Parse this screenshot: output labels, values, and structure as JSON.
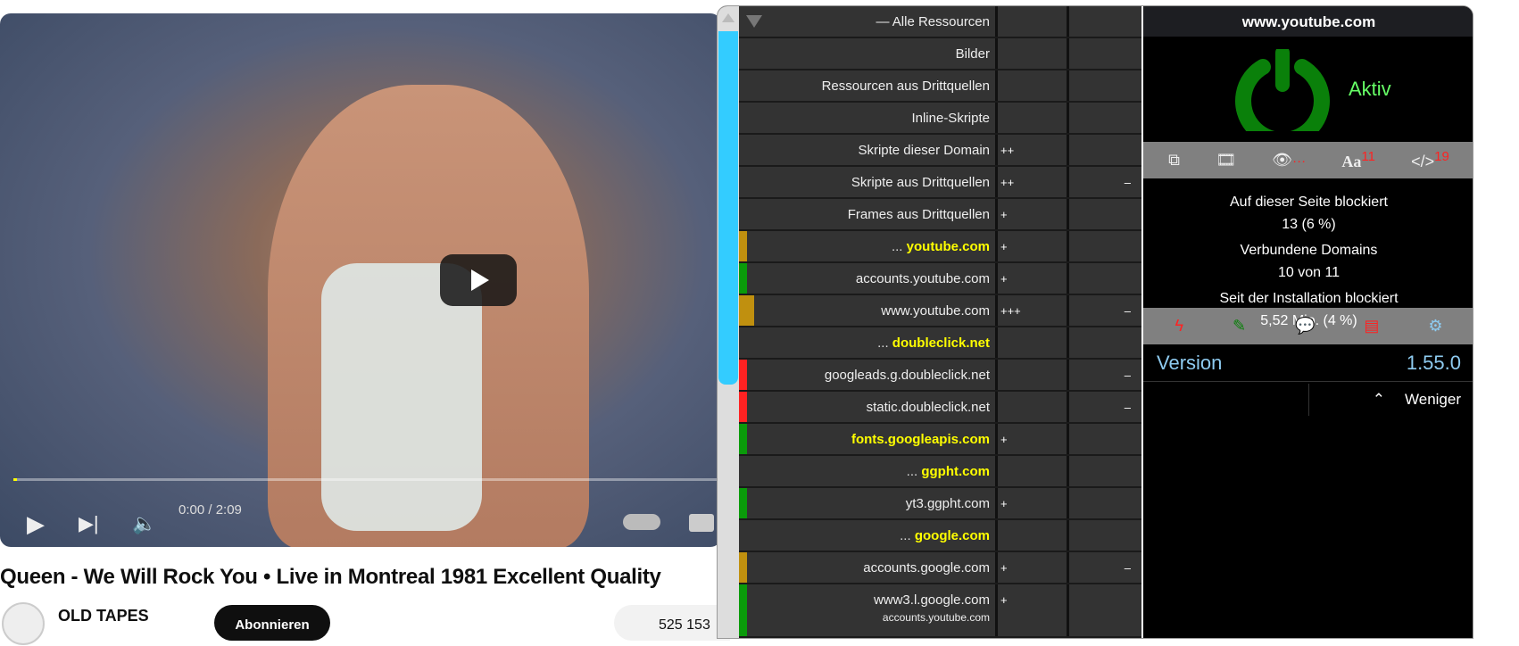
{
  "video": {
    "time": "0:00 / 2:09",
    "title": "Queen - We Will Rock You • Live in Montreal 1981 Excellent Quality",
    "channel": "OLD TAPES",
    "subscribe": "Abonnieren",
    "likes": "525 153"
  },
  "filter_rows": [
    {
      "label": "— Alle Ressourcen",
      "plus": "",
      "minus": "",
      "bar": "",
      "barw": 0
    },
    {
      "label": "Bilder",
      "plus": "",
      "minus": ""
    },
    {
      "label": "Ressourcen aus Drittquellen",
      "plus": "",
      "minus": ""
    },
    {
      "label": "Inline-Skripte",
      "plus": "",
      "minus": ""
    },
    {
      "label": "Skripte dieser Domain",
      "plus": "++",
      "minus": ""
    },
    {
      "label": "Skripte aus Drittquellen",
      "plus": "++",
      "minus": "–"
    },
    {
      "label": "Frames aus Drittquellen",
      "plus": "+",
      "minus": ""
    }
  ],
  "domain_rows": [
    {
      "prefix": "...",
      "label": "youtube.com",
      "highlight": true,
      "plus": "+",
      "minus": "",
      "bar": "#c0900f",
      "barw": 9
    },
    {
      "prefix": "",
      "label": "accounts.youtube.com",
      "highlight": false,
      "plus": "+",
      "minus": "",
      "bar": "#0a9a0a",
      "barw": 9
    },
    {
      "prefix": "",
      "label": "www.youtube.com",
      "highlight": false,
      "plus": "+++",
      "minus": "–",
      "bar": "#c0900f",
      "barw": 17
    },
    {
      "prefix": "...",
      "label": "doubleclick.net",
      "highlight": true,
      "plus": "",
      "minus": "",
      "bar": "",
      "barw": 0
    },
    {
      "prefix": "",
      "label": "googleads.g.doubleclick.net",
      "highlight": false,
      "plus": "",
      "minus": "–",
      "bar": "#f22",
      "barw": 9
    },
    {
      "prefix": "",
      "label": "static.doubleclick.net",
      "highlight": false,
      "plus": "",
      "minus": "–",
      "bar": "#f22",
      "barw": 9
    },
    {
      "prefix": "",
      "label": "fonts.googleapis.com",
      "highlight": true,
      "plus": "+",
      "minus": "",
      "bar": "#0a9a0a",
      "barw": 9
    },
    {
      "prefix": "...",
      "label": "ggpht.com",
      "highlight": true,
      "plus": "",
      "minus": "",
      "bar": "",
      "barw": 0
    },
    {
      "prefix": "",
      "label": "yt3.ggpht.com",
      "highlight": false,
      "plus": "+",
      "minus": "",
      "bar": "#0a9a0a",
      "barw": 9
    },
    {
      "prefix": "...",
      "label": "google.com",
      "highlight": true,
      "plus": "",
      "minus": "",
      "bar": "",
      "barw": 0
    },
    {
      "prefix": "",
      "label": "accounts.google.com",
      "highlight": false,
      "plus": "+",
      "minus": "–",
      "bar": "#c0900f",
      "barw": 9
    },
    {
      "prefix": "",
      "label": "www3.l.google.com",
      "sub": "accounts.youtube.com",
      "highlight": false,
      "plus": "+",
      "minus": "",
      "bar": "#0a9a0a",
      "barw": 9
    }
  ],
  "panel": {
    "hostname": "www.youtube.com",
    "status": "Aktiv",
    "counts": {
      "dots": "···",
      "fonts_label": "Aa",
      "fonts": "11",
      "scripts_label": "</>",
      "scripts": "19"
    },
    "blocked_page_label": "Auf dieser Seite blockiert",
    "blocked_page": "13 (6 %)",
    "domains_label": "Verbundene Domains",
    "domains": "10 von 11",
    "blocked_total_label": "Seit der Installation blockiert",
    "blocked_total": "5,52 Mio. (4 %)",
    "version_label": "Version",
    "version": "1.55.0",
    "less": "Weniger"
  }
}
